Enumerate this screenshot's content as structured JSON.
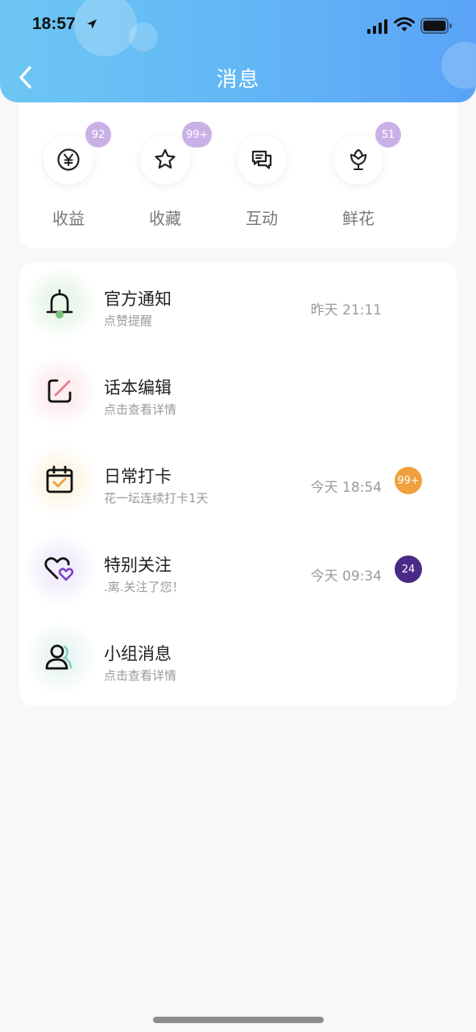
{
  "status_bar": {
    "time": "18:57"
  },
  "header": {
    "title": "消息"
  },
  "quick_actions": [
    {
      "label": "收益",
      "badge": "92",
      "icon": "yen-icon"
    },
    {
      "label": "收藏",
      "badge": "99+",
      "icon": "star-icon"
    },
    {
      "label": "互动",
      "badge": "",
      "icon": "chat-icon"
    },
    {
      "label": "鲜花",
      "badge": "51",
      "icon": "flower-icon"
    }
  ],
  "messages": [
    {
      "title": "官方通知",
      "subtitle": "点赞提醒",
      "time": "昨天 21:11",
      "badge": "",
      "icon": "bell-icon",
      "glow": "#eef8ee"
    },
    {
      "title": "话本编辑",
      "subtitle": "点击查看详情",
      "time": "",
      "badge": "",
      "icon": "edit-icon",
      "glow": "#fdf0f1"
    },
    {
      "title": "日常打卡",
      "subtitle": "花一坛连续打卡1天",
      "time": "今天 18:54",
      "badge": "99+",
      "badge_color": "#f0a03c",
      "icon": "calendar-check-icon",
      "glow": "#fdf7ea"
    },
    {
      "title": "特别关注",
      "subtitle": ".离.关注了您！",
      "time": "今天 09:34",
      "badge": "24",
      "badge_color": "#4a2a86",
      "icon": "hearts-icon",
      "glow": "#f4f0fb"
    },
    {
      "title": "小组消息",
      "subtitle": "点击查看详情",
      "time": "",
      "badge": "",
      "icon": "group-icon",
      "glow": "#eef8f6"
    }
  ]
}
